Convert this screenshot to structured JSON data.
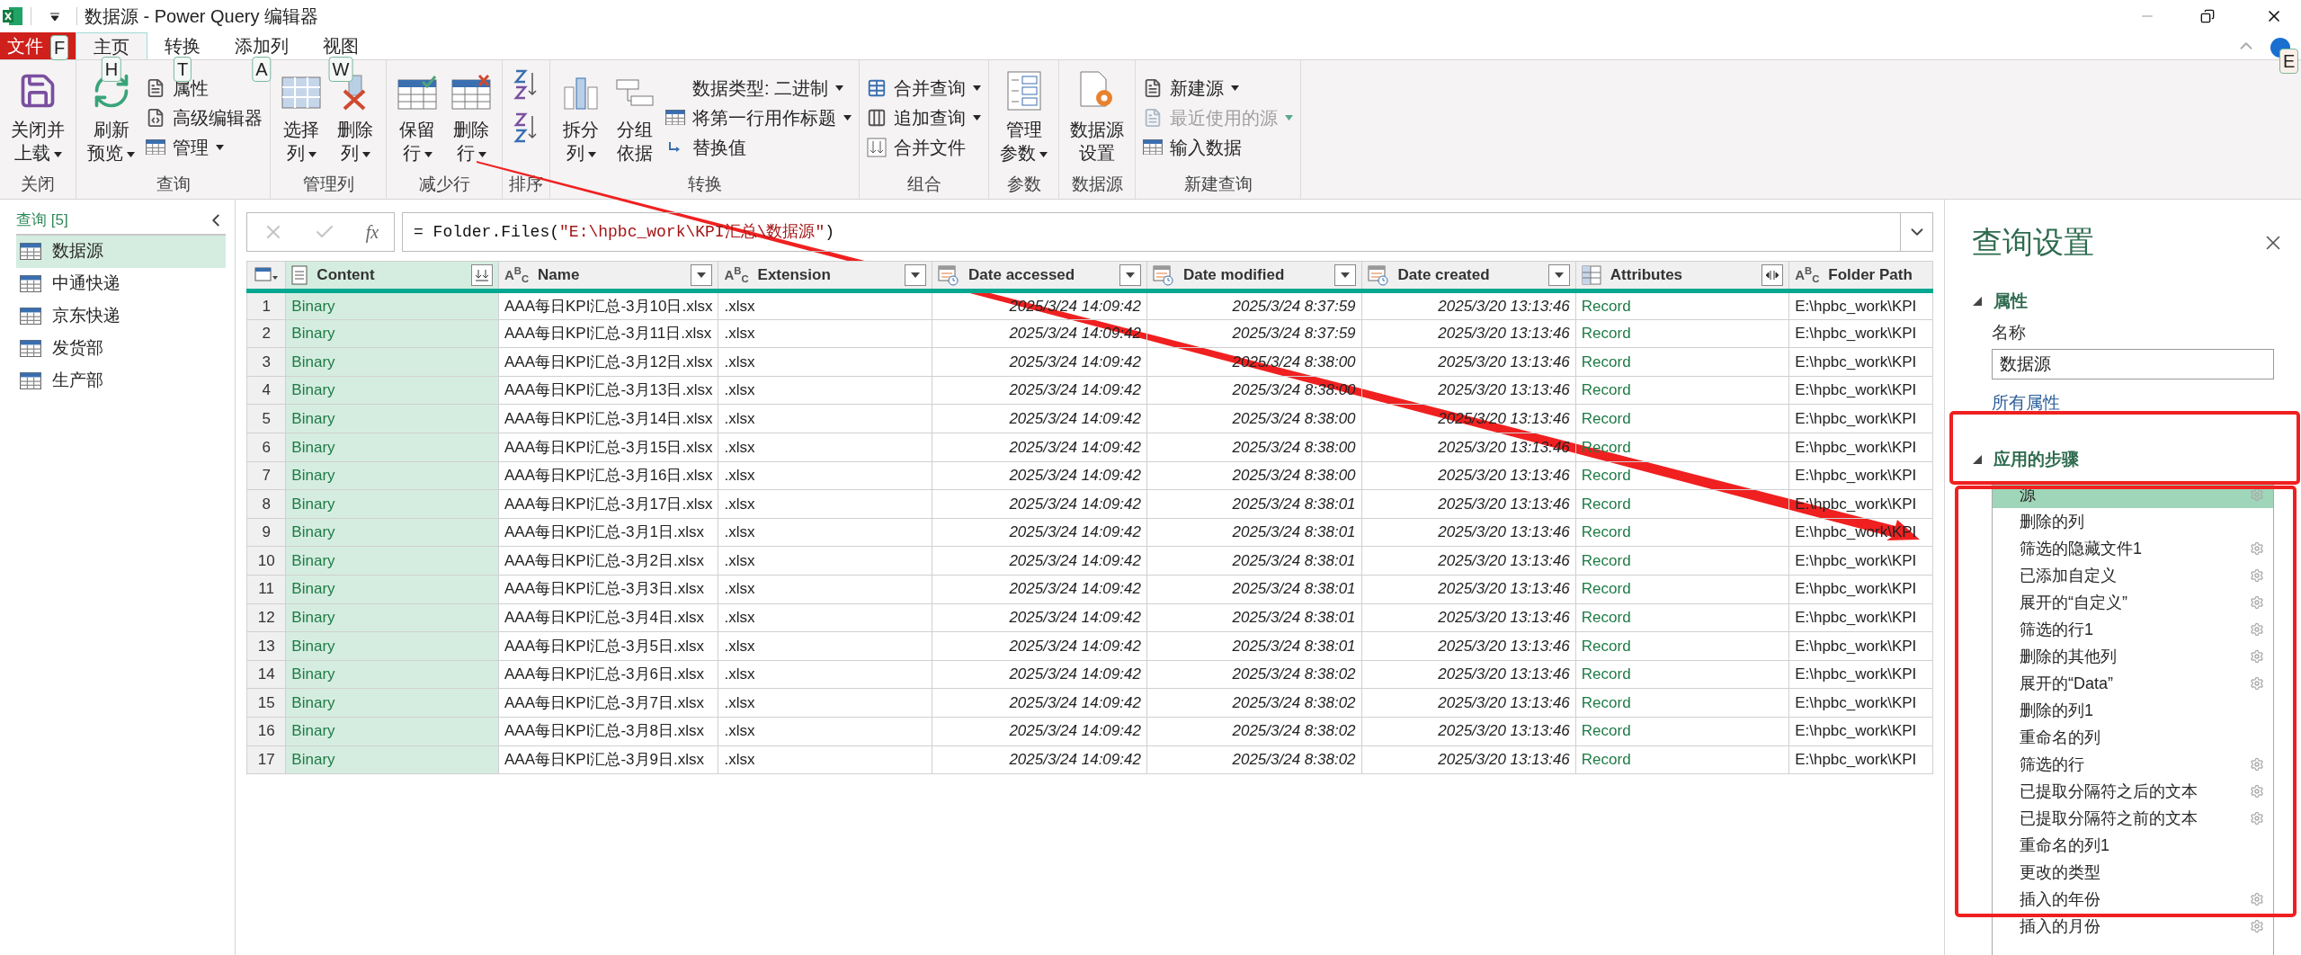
{
  "window": {
    "title": "数据源 - Power Query 编辑器"
  },
  "tabs": [
    {
      "label": "文件",
      "kind": "file",
      "keytip": "F",
      "selected": false
    },
    {
      "label": "主页",
      "kind": "tab",
      "keytip": "H",
      "selected": true
    },
    {
      "label": "转换",
      "kind": "tab",
      "keytip": "T",
      "selected": false
    },
    {
      "label": "添加列",
      "kind": "tab",
      "keytip": "A",
      "selected": false
    },
    {
      "label": "视图",
      "kind": "tab",
      "keytip": "W",
      "selected": false
    }
  ],
  "help_keytip": "E",
  "ribbon": [
    {
      "label": "关闭",
      "items": [
        {
          "kind": "large",
          "lines": [
            "关闭并",
            "上载"
          ],
          "dropdown": true
        }
      ]
    },
    {
      "label": "查询",
      "items": [
        {
          "kind": "large",
          "lines": [
            "刷新",
            "预览"
          ],
          "dropdown": true
        },
        {
          "kind": "stack",
          "items": [
            {
              "label": "属性",
              "dropdown": false,
              "disabled": false
            },
            {
              "label": "高级编辑器",
              "dropdown": false,
              "disabled": false
            },
            {
              "label": "管理",
              "dropdown": true,
              "disabled": false
            }
          ]
        }
      ]
    },
    {
      "label": "管理列",
      "items": [
        {
          "kind": "large",
          "lines": [
            "选择",
            "列"
          ],
          "dropdown": true
        },
        {
          "kind": "large",
          "lines": [
            "删除",
            "列"
          ],
          "dropdown": true
        }
      ]
    },
    {
      "label": "减少行",
      "items": [
        {
          "kind": "large",
          "lines": [
            "保留",
            "行"
          ],
          "dropdown": true
        },
        {
          "kind": "large",
          "lines": [
            "删除",
            "行"
          ],
          "dropdown": true
        }
      ]
    },
    {
      "label": "排序",
      "items": [
        {
          "kind": "sort"
        }
      ]
    },
    {
      "label": "转换",
      "items": [
        {
          "kind": "large",
          "lines": [
            "拆分",
            "列"
          ],
          "dropdown": true
        },
        {
          "kind": "large",
          "lines": [
            "分组",
            "依据"
          ],
          "dropdown": false
        },
        {
          "kind": "stack",
          "items": [
            {
              "label": "数据类型: 二进制",
              "dropdown": true,
              "disabled": false
            },
            {
              "label": "将第一行用作标题",
              "dropdown": true,
              "disabled": false
            },
            {
              "label": "替换值",
              "dropdown": false,
              "disabled": false
            }
          ]
        }
      ]
    },
    {
      "label": "组合",
      "items": [
        {
          "kind": "stack",
          "items": [
            {
              "label": "合并查询",
              "dropdown": true,
              "disabled": false
            },
            {
              "label": "追加查询",
              "dropdown": true,
              "disabled": false
            },
            {
              "label": "合并文件",
              "dropdown": false,
              "disabled": false
            }
          ]
        }
      ]
    },
    {
      "label": "参数",
      "items": [
        {
          "kind": "large",
          "lines": [
            "管理",
            "参数"
          ],
          "dropdown": true
        }
      ]
    },
    {
      "label": "数据源",
      "items": [
        {
          "kind": "large",
          "lines": [
            "数据源",
            "设置"
          ],
          "dropdown": false
        }
      ]
    },
    {
      "label": "新建查询",
      "items": [
        {
          "kind": "stack",
          "items": [
            {
              "label": "新建源",
              "dropdown": true,
              "disabled": false
            },
            {
              "label": "最近使用的源",
              "dropdown": true,
              "disabled": true
            },
            {
              "label": "输入数据",
              "dropdown": false,
              "disabled": false
            }
          ]
        }
      ]
    }
  ],
  "queries": {
    "header": "查询 [5]",
    "items": [
      {
        "label": "数据源",
        "selected": true
      },
      {
        "label": "中通快递",
        "selected": false
      },
      {
        "label": "京东快递",
        "selected": false
      },
      {
        "label": "发货部",
        "selected": false
      },
      {
        "label": "生产部",
        "selected": false
      }
    ]
  },
  "formula_bar": {
    "function_label": "fx",
    "formula": [
      {
        "kind": "plain",
        "text": "= Folder.Files("
      },
      {
        "kind": "string",
        "text": "\"E:\\hpbc_work\\KPI汇总\\数据源\""
      },
      {
        "kind": "plain",
        "text": ")"
      }
    ]
  },
  "table": {
    "columns": [
      {
        "label": "Content",
        "kind": "binary",
        "header_button": true,
        "tinted": true
      },
      {
        "label": "Name",
        "kind": "text",
        "type_glyph": "A$^{B}$$_{C}$",
        "header_button": true,
        "tinted": false
      },
      {
        "label": "Extension",
        "kind": "text",
        "type_glyph": "A$^{B}$$_{C}$",
        "header_button": true,
        "tinted": false
      },
      {
        "label": "Date accessed",
        "kind": "datetime",
        "header_button": true,
        "tinted": false
      },
      {
        "label": "Date modified",
        "kind": "datetime",
        "header_button": true,
        "tinted": false
      },
      {
        "label": "Date created",
        "kind": "datetime",
        "header_button": true,
        "tinted": false
      },
      {
        "label": "Attributes",
        "kind": "record",
        "header_button": true,
        "tinted": false
      },
      {
        "label": "Folder Path",
        "kind": "text",
        "type_glyph": "A$^{B}$$_{C}$",
        "header_button": false,
        "tinted": false
      }
    ],
    "rows": [
      {
        "number": "1",
        "cells": [
          "Binary",
          "AAA每日KPI汇总-3月10日.xlsx",
          ".xlsx",
          "2025/3/24 14:09:42",
          "2025/3/24 8:37:59",
          "2025/3/20 13:13:46",
          "Record",
          "E:\\hpbc_work\\KPI"
        ]
      },
      {
        "number": "2",
        "cells": [
          "Binary",
          "AAA每日KPI汇总-3月11日.xlsx",
          ".xlsx",
          "2025/3/24 14:09:42",
          "2025/3/24 8:37:59",
          "2025/3/20 13:13:46",
          "Record",
          "E:\\hpbc_work\\KPI"
        ]
      },
      {
        "number": "3",
        "cells": [
          "Binary",
          "AAA每日KPI汇总-3月12日.xlsx",
          ".xlsx",
          "2025/3/24 14:09:42",
          "2025/3/24 8:38:00",
          "2025/3/20 13:13:46",
          "Record",
          "E:\\hpbc_work\\KPI"
        ]
      },
      {
        "number": "4",
        "cells": [
          "Binary",
          "AAA每日KPI汇总-3月13日.xlsx",
          ".xlsx",
          "2025/3/24 14:09:42",
          "2025/3/24 8:38:00",
          "2025/3/20 13:13:46",
          "Record",
          "E:\\hpbc_work\\KPI"
        ]
      },
      {
        "number": "5",
        "cells": [
          "Binary",
          "AAA每日KPI汇总-3月14日.xlsx",
          ".xlsx",
          "2025/3/24 14:09:42",
          "2025/3/24 8:38:00",
          "2025/3/20 13:13:46",
          "Record",
          "E:\\hpbc_work\\KPI"
        ]
      },
      {
        "number": "6",
        "cells": [
          "Binary",
          "AAA每日KPI汇总-3月15日.xlsx",
          ".xlsx",
          "2025/3/24 14:09:42",
          "2025/3/24 8:38:00",
          "2025/3/20 13:13:46",
          "Record",
          "E:\\hpbc_work\\KPI"
        ]
      },
      {
        "number": "7",
        "cells": [
          "Binary",
          "AAA每日KPI汇总-3月16日.xlsx",
          ".xlsx",
          "2025/3/24 14:09:42",
          "2025/3/24 8:38:00",
          "2025/3/20 13:13:46",
          "Record",
          "E:\\hpbc_work\\KPI"
        ]
      },
      {
        "number": "8",
        "cells": [
          "Binary",
          "AAA每日KPI汇总-3月17日.xlsx",
          ".xlsx",
          "2025/3/24 14:09:42",
          "2025/3/24 8:38:01",
          "2025/3/20 13:13:46",
          "Record",
          "E:\\hpbc_work\\KPI"
        ]
      },
      {
        "number": "9",
        "cells": [
          "Binary",
          "AAA每日KPI汇总-3月1日.xlsx",
          ".xlsx",
          "2025/3/24 14:09:42",
          "2025/3/24 8:38:01",
          "2025/3/20 13:13:46",
          "Record",
          "E:\\hpbc_work\\KPI"
        ]
      },
      {
        "number": "10",
        "cells": [
          "Binary",
          "AAA每日KPI汇总-3月2日.xlsx",
          ".xlsx",
          "2025/3/24 14:09:42",
          "2025/3/24 8:38:01",
          "2025/3/20 13:13:46",
          "Record",
          "E:\\hpbc_work\\KPI"
        ]
      },
      {
        "number": "11",
        "cells": [
          "Binary",
          "AAA每日KPI汇总-3月3日.xlsx",
          ".xlsx",
          "2025/3/24 14:09:42",
          "2025/3/24 8:38:01",
          "2025/3/20 13:13:46",
          "Record",
          "E:\\hpbc_work\\KPI"
        ]
      },
      {
        "number": "12",
        "cells": [
          "Binary",
          "AAA每日KPI汇总-3月4日.xlsx",
          ".xlsx",
          "2025/3/24 14:09:42",
          "2025/3/24 8:38:01",
          "2025/3/20 13:13:46",
          "Record",
          "E:\\hpbc_work\\KPI"
        ]
      },
      {
        "number": "13",
        "cells": [
          "Binary",
          "AAA每日KPI汇总-3月5日.xlsx",
          ".xlsx",
          "2025/3/24 14:09:42",
          "2025/3/24 8:38:01",
          "2025/3/20 13:13:46",
          "Record",
          "E:\\hpbc_work\\KPI"
        ]
      },
      {
        "number": "14",
        "cells": [
          "Binary",
          "AAA每日KPI汇总-3月6日.xlsx",
          ".xlsx",
          "2025/3/24 14:09:42",
          "2025/3/24 8:38:02",
          "2025/3/20 13:13:46",
          "Record",
          "E:\\hpbc_work\\KPI"
        ]
      },
      {
        "number": "15",
        "cells": [
          "Binary",
          "AAA每日KPI汇总-3月7日.xlsx",
          ".xlsx",
          "2025/3/24 14:09:42",
          "2025/3/24 8:38:02",
          "2025/3/20 13:13:46",
          "Record",
          "E:\\hpbc_work\\KPI"
        ]
      },
      {
        "number": "16",
        "cells": [
          "Binary",
          "AAA每日KPI汇总-3月8日.xlsx",
          ".xlsx",
          "2025/3/24 14:09:42",
          "2025/3/24 8:38:02",
          "2025/3/20 13:13:46",
          "Record",
          "E:\\hpbc_work\\KPI"
        ]
      },
      {
        "number": "17",
        "cells": [
          "Binary",
          "AAA每日KPI汇总-3月9日.xlsx",
          ".xlsx",
          "2025/3/24 14:09:42",
          "2025/3/24 8:38:02",
          "2025/3/20 13:13:46",
          "Record",
          "E:\\hpbc_work\\KPI"
        ]
      }
    ]
  },
  "query_settings": {
    "title": "查询设置",
    "properties": {
      "heading": "属性",
      "expanded": true,
      "name_label": "名称",
      "name_value": "数据源",
      "all_properties_link": "所有属性"
    },
    "steps_section": {
      "heading": "应用的步骤",
      "expanded": true
    },
    "steps": [
      {
        "label": "源",
        "gear": true,
        "selected": true
      },
      {
        "label": "删除的列",
        "gear": false,
        "selected": false
      },
      {
        "label": "筛选的隐藏文件1",
        "gear": true,
        "selected": false
      },
      {
        "label": "已添加自定义",
        "gear": true,
        "selected": false
      },
      {
        "label": "展开的“自定义”",
        "gear": true,
        "selected": false
      },
      {
        "label": "筛选的行1",
        "gear": true,
        "selected": false
      },
      {
        "label": "删除的其他列",
        "gear": true,
        "selected": false
      },
      {
        "label": "展开的“Data”",
        "gear": true,
        "selected": false
      },
      {
        "label": "删除的列1",
        "gear": false,
        "selected": false
      },
      {
        "label": "重命名的列",
        "gear": false,
        "selected": false
      },
      {
        "label": "筛选的行",
        "gear": true,
        "selected": false
      },
      {
        "label": "已提取分隔符之后的文本",
        "gear": true,
        "selected": false
      },
      {
        "label": "已提取分隔符之前的文本",
        "gear": true,
        "selected": false
      },
      {
        "label": "重命名的列1",
        "gear": false,
        "selected": false
      },
      {
        "label": "更改的类型",
        "gear": false,
        "selected": false
      },
      {
        "label": "插入的年份",
        "gear": true,
        "selected": false
      },
      {
        "label": "插入的月份",
        "gear": true,
        "selected": false
      }
    ]
  }
}
